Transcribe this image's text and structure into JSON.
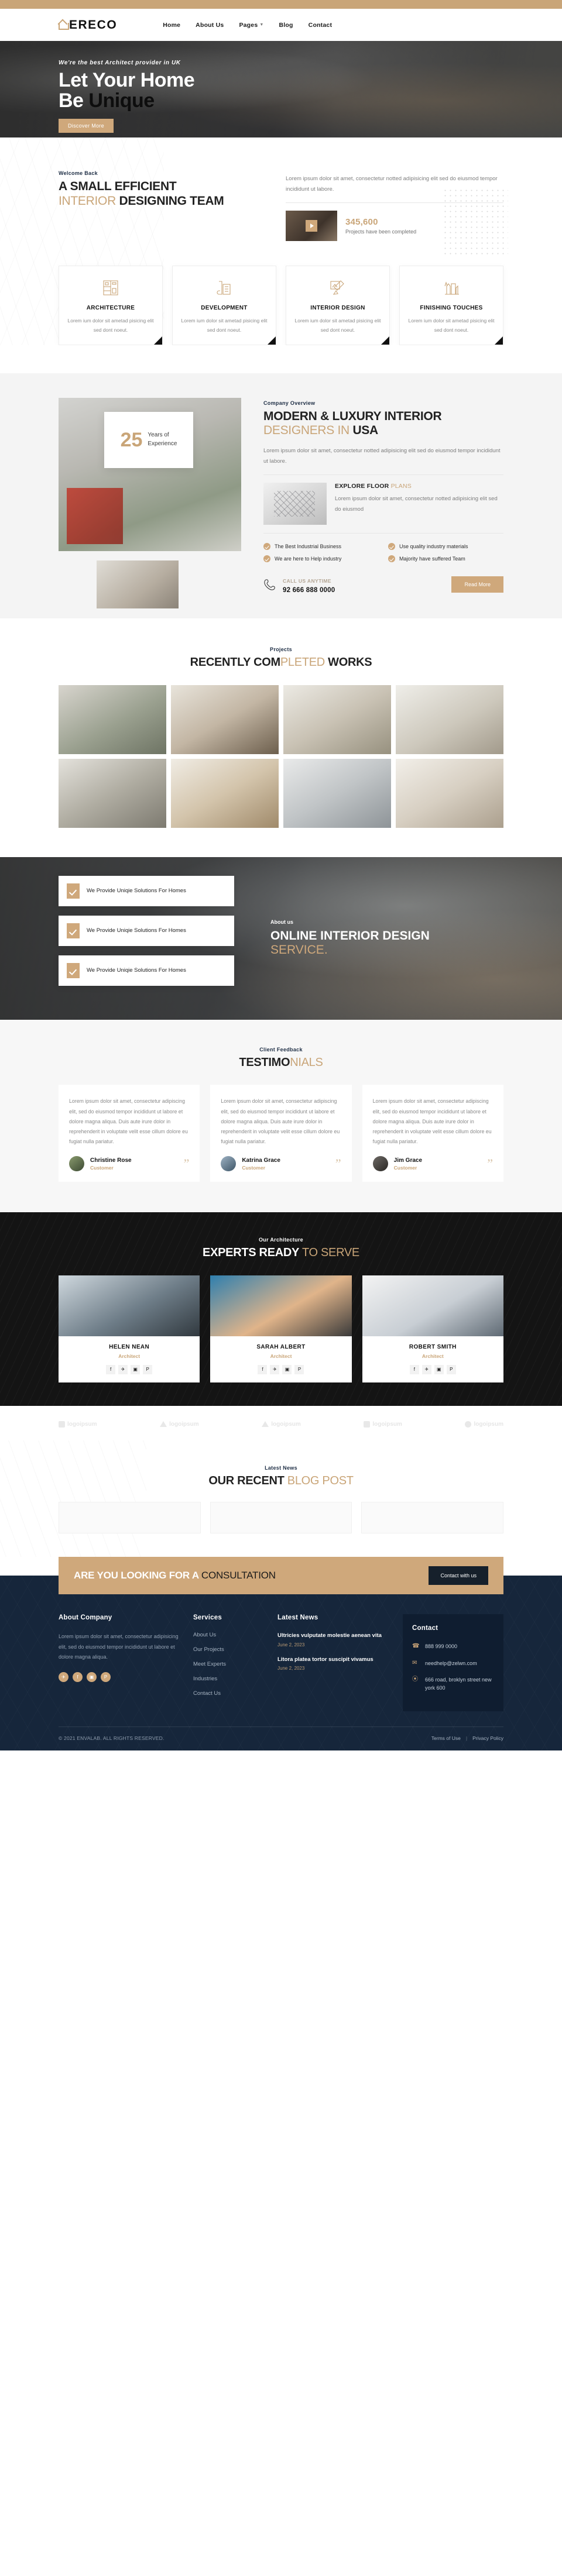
{
  "brand": {
    "name": "ERECO",
    "accent": "#c9a578",
    "dark": "#16263b"
  },
  "nav": {
    "links": [
      {
        "label": "Home",
        "caret": false
      },
      {
        "label": "About Us",
        "caret": false
      },
      {
        "label": "Pages",
        "caret": true
      },
      {
        "label": "Blog",
        "caret": false
      },
      {
        "label": "Contact",
        "caret": false
      }
    ]
  },
  "hero": {
    "subtitle": "We're the best Architect provider in UK",
    "title_line1_light": "Let Your Home",
    "title_line2_light": "Be ",
    "title_line2_dark": "Unique",
    "button": "Discover More"
  },
  "welcome": {
    "eyebrow": "Welcome Back",
    "title_line1": "A SMALL EFFICIENT",
    "title_line2_light": "INTERIOR ",
    "title_line2_dark": "DESIGNING TEAM",
    "paragraph": "Lorem ipsum dolor sit amet, consectetur notted adipisicing elit sed do eiusmod tempor incididunt ut labore.",
    "count": "345,600",
    "count_label": "Projects have been completed"
  },
  "services": [
    {
      "title": "ARCHITECTURE",
      "text": "Lorem ium dolor sit ametad pisicing elit sed dont noeut.",
      "icon": "floorplan-icon"
    },
    {
      "title": "DEVELOPMENT",
      "text": "Lorem ium dolor sit ametad pisicing elit sed dont noeut.",
      "icon": "blueprint-roll-icon"
    },
    {
      "title": "INTERIOR DESIGN",
      "text": "Lorem ium dolor sit ametad pisicing elit sed dont noeut.",
      "icon": "drafting-icon"
    },
    {
      "title": "FINISHING TOUCHES",
      "text": "Lorem ium dolor sit ametad pisicing elit sed dont noeut.",
      "icon": "skyline-pencil-icon"
    }
  ],
  "overview": {
    "badge_number": "25",
    "badge_text_line1": "Years of",
    "badge_text_line2": "Experience",
    "eyebrow": "Company Overview",
    "title_line1": "MODERN & LUXURY INTERIOR",
    "title_line2_light": "DESIGNERS IN ",
    "title_line2_dark": "USA",
    "paragraph": "Lorem ipsum dolor sit amet, consectetur notted adipisicing elit sed do eiusmod tempor incididunt ut labore.",
    "floor_title_dark": "EXPLORE FLOOR ",
    "floor_title_light": "PLANS",
    "floor_text": "Lorem ipsum dolor sit amet, consectetur notted adipisicing elit sed do eiusmod",
    "features": [
      "The Best Industrial Business",
      "Use quality industry materials",
      "We are here to Help industry",
      "Majority have suffered Team"
    ],
    "call_label": "CALL US ANYTIME",
    "call_number": "92 666 888 0000",
    "button": "Read More"
  },
  "projects": {
    "eyebrow": "Projects",
    "title_a": "RECENTLY COM",
    "title_b": "PLETED",
    "title_c": " WORKS",
    "items": [
      "p1",
      "p2",
      "p3",
      "p4",
      "p5",
      "p6",
      "p7",
      "p8"
    ]
  },
  "online": {
    "eyebrow": "About us",
    "title_line1": "ONLINE INTERIOR DESIGN",
    "title_line2": "SERVICE.",
    "cards": [
      "We Provide Uniqie Solutions For Homes",
      "We Provide Uniqie Solutions For Homes",
      "We Provide Uniqie Solutions For Homes"
    ]
  },
  "testimonials": {
    "eyebrow": "Client Feedback",
    "title_a": "TESTIMO",
    "title_b": "NIALS",
    "quote_glyph": "”",
    "items": [
      {
        "text": "Lorem ipsum dolor sit amet, consectetur adipiscing elit, sed do eiusmod tempor incididunt ut labore et dolore magna aliqua. Duis aute irure dolor in reprehenderit in voluptate velit esse cillum dolore eu fugiat nulla pariatur.",
        "name": "Christine Rose",
        "role": "Customer"
      },
      {
        "text": "Lorem ipsum dolor sit amet, consectetur adipiscing elit, sed do eiusmod tempor incididunt ut labore et dolore magna aliqua. Duis aute irure dolor in reprehenderit in voluptate velit esse cillum dolore eu fugiat nulla pariatur.",
        "name": "Katrina Grace",
        "role": "Customer"
      },
      {
        "text": "Lorem ipsum dolor sit amet, consectetur adipiscing elit, sed do eiusmod tempor incididunt ut labore et dolore magna aliqua. Duis aute irure dolor in reprehenderit in voluptate velit esse cillum dolore eu fugiat nulla pariatur.",
        "name": "Jim Grace",
        "role": "Customer"
      }
    ]
  },
  "team": {
    "eyebrow": "Our Architecture",
    "title_a": "EXPERTS READY ",
    "title_b": "TO SERVE",
    "members": [
      {
        "name": "HELEN NEAN",
        "role": "Architect"
      },
      {
        "name": "SARAH ALBERT",
        "role": "Architect"
      },
      {
        "name": "ROBERT SMITH",
        "role": "Architect"
      }
    ],
    "social_icons": [
      "f",
      "✈",
      "▣",
      "P"
    ]
  },
  "logos": [
    {
      "label": "logoipsum",
      "shape": "lg-bar"
    },
    {
      "label": "logoipsum",
      "shape": "lg-tri"
    },
    {
      "label": "logoipsum",
      "shape": "lg-tri"
    },
    {
      "label": "logoipsum",
      "shape": "lg-bar"
    },
    {
      "label": "logoipsum",
      "shape": "lg-round"
    }
  ],
  "blog": {
    "eyebrow": "Latest News",
    "title_a": "OUR RECENT ",
    "title_b": "BLOG POST"
  },
  "cta": {
    "title_light": "ARE YOU LOOKING FOR A ",
    "title_dark": "CONSULTATION",
    "button": "Contact with us"
  },
  "footer": {
    "about": {
      "heading": "About Company",
      "text": "Lorem ipsum dolor sit amet, consectetur adipisicing elit, sed do eiusmod tempor incididunt ut labore et dolore magna aliqua.",
      "socials": [
        "✈",
        "f",
        "▣",
        "P"
      ]
    },
    "services": {
      "heading": "Services",
      "links": [
        "About Us",
        "Our Projects",
        "Meet Experts",
        "Industries",
        "Contact Us"
      ]
    },
    "news": {
      "heading": "Latest News",
      "items": [
        {
          "title": "Ultricies vulputate molestie aenean vita",
          "date": "June 2, 2023"
        },
        {
          "title": "Litora platea tortor suscipit vivamus",
          "date": "June 2, 2023"
        }
      ]
    },
    "contact": {
      "heading": "Contact",
      "rows": [
        {
          "icon": "phone-icon",
          "glyph": "☎",
          "text": "888 999 0000"
        },
        {
          "icon": "mail-icon",
          "glyph": "✉",
          "text": "needhelp@zelwn.com"
        },
        {
          "icon": "location-icon",
          "glyph": "⦿",
          "text": "666 road, broklyn street new york 600"
        }
      ]
    },
    "copyright": "© 2021 ENVALAB. ALL RIGHTS RESERVED.",
    "bottom_links": [
      "Terms of Use",
      "Privacy Policy"
    ],
    "bottom_sep": "|"
  }
}
